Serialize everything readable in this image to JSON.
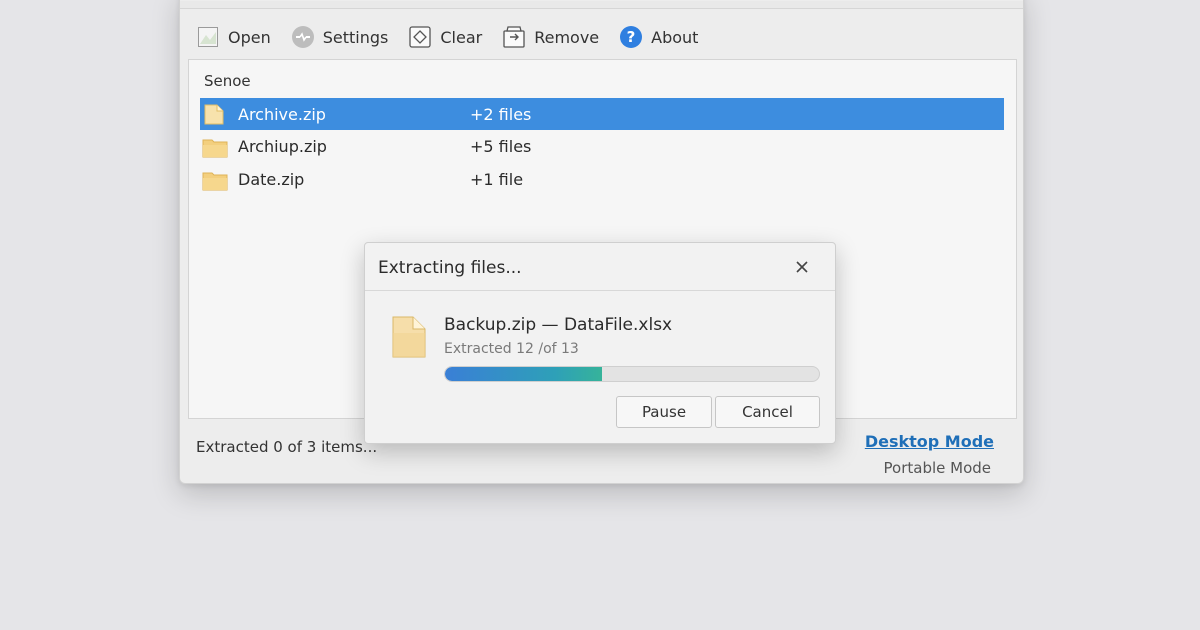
{
  "toolbar": {
    "items": [
      {
        "label": "Open",
        "icon": "open-icon"
      },
      {
        "label": "Settings",
        "icon": "settings-icon"
      },
      {
        "label": "Clear",
        "icon": "clear-icon"
      },
      {
        "label": "Remove",
        "icon": "remove-icon"
      },
      {
        "label": "About",
        "icon": "about-icon"
      }
    ]
  },
  "file_list": {
    "header": "Senoe",
    "rows": [
      {
        "name": "Archive.zip",
        "count": "+2 files",
        "selected": true
      },
      {
        "name": "Archiup.zip",
        "count": "+5 files",
        "selected": false
      },
      {
        "name": "Date.zip",
        "count": "+1 file",
        "selected": false
      }
    ]
  },
  "status": {
    "text": "Extracted 0 of 3 items...",
    "desktop_mode": "Desktop Mode",
    "portable_mode": "Portable Mode"
  },
  "dialog": {
    "title": "Extracting files...",
    "file_name": "Backup.zip — DataFile.xlsx",
    "progress_text": "Extracted 12 /of 13",
    "progress_fraction": 0.42,
    "pause_label": "Pause",
    "cancel_label": "Cancel"
  },
  "colors": {
    "selection": "#3d8ddf",
    "link": "#1f6fb8",
    "about_icon": "#2f7fe0",
    "folder": "#f3cf7e",
    "progress_start": "#3a7fd6",
    "progress_end": "#36b39a"
  }
}
